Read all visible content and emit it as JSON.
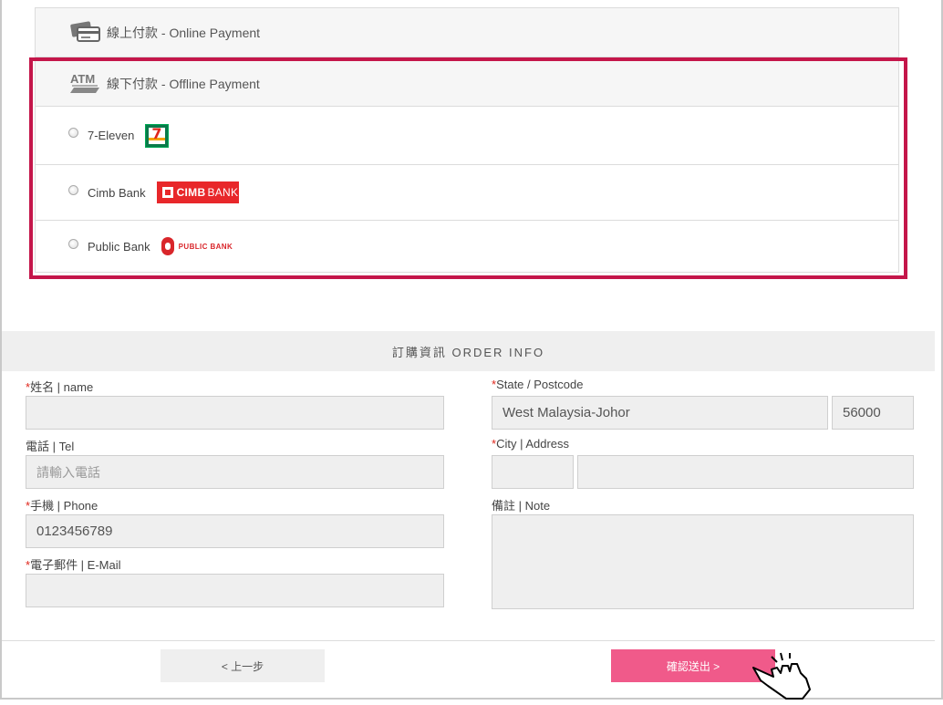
{
  "payment": {
    "online": {
      "label": "線上付款 - Online Payment",
      "icon": "card-icon"
    },
    "offline": {
      "label": "線下付款 - Offline Payment",
      "icon_text": "ATM",
      "options": [
        {
          "label": "7-Eleven",
          "logo": "seven-eleven-logo"
        },
        {
          "label": "Cimb Bank",
          "logo": "cimb-bank-logo",
          "logo_text": "CIMB",
          "logo_text2": "BANK"
        },
        {
          "label": "Public Bank",
          "logo": "public-bank-logo",
          "logo_text": "PUBLIC BANK"
        }
      ]
    },
    "highlight_color": "#c4164a"
  },
  "order": {
    "title": "訂購資訊 ORDER INFO",
    "fields": {
      "name": {
        "label": "姓名 | name",
        "required": "*",
        "value": ""
      },
      "tel": {
        "label": "電話 | Tel",
        "placeholder": "請輸入電話"
      },
      "phone": {
        "label": "手機 | Phone",
        "required": "*",
        "value": "0123456789"
      },
      "email": {
        "label": "電子郵件 | E-Mail",
        "required": "*",
        "value": ""
      },
      "state": {
        "label": "State / Postcode",
        "required": "*",
        "value": "West Malaysia-Johor",
        "postcode": "56000"
      },
      "city": {
        "label": "City | Address",
        "required": "*",
        "city": "",
        "address": ""
      },
      "note": {
        "label": "備註 | Note",
        "value": ""
      }
    }
  },
  "buttons": {
    "prev": "< 上一步",
    "submit": "確認送出 >",
    "submit_color": "#f05a8a"
  }
}
